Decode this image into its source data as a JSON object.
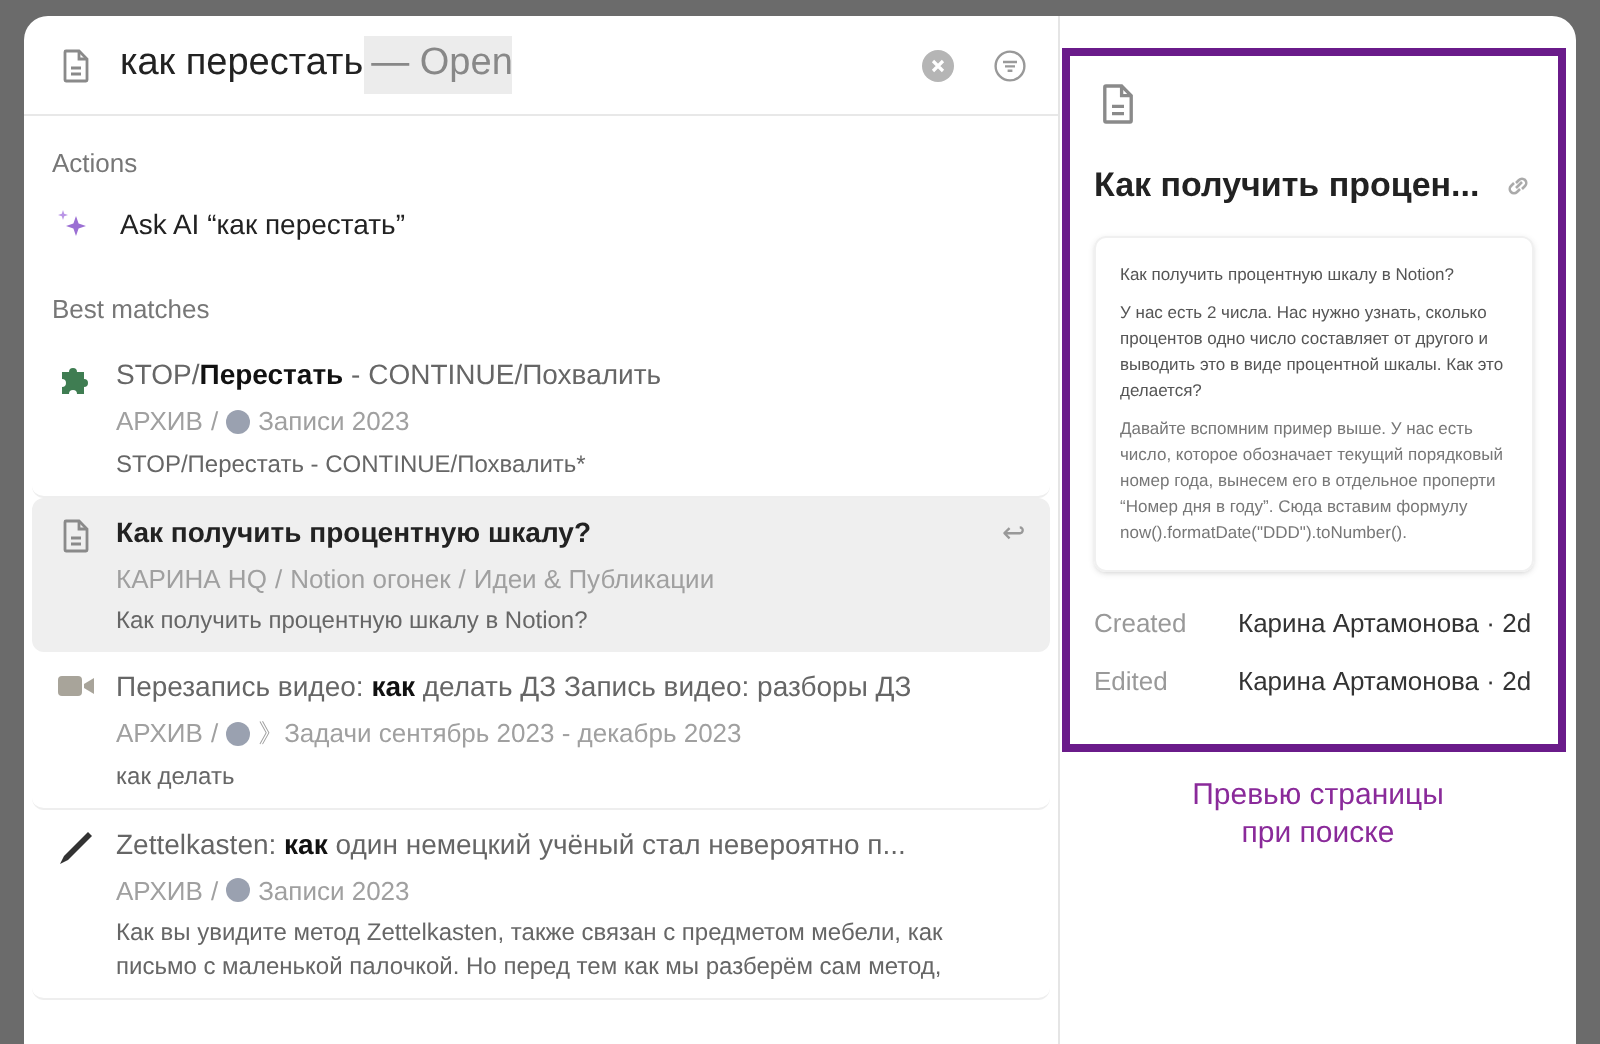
{
  "search": {
    "value": "как перестать",
    "suggestion": "— Open"
  },
  "actions": {
    "heading": "Actions",
    "items": [
      {
        "label": "Ask AI “как перестать”"
      }
    ]
  },
  "results": {
    "heading": "Best matches",
    "items": [
      {
        "kind": "puzzle",
        "selected": false,
        "title": "STOP/**Перестать** - CONTINUE/Похвалить",
        "breadcrumb": [
          {
            "kind": "text",
            "text": "АРХИВ"
          },
          {
            "kind": "text",
            "text": "/"
          },
          {
            "kind": "dot"
          },
          {
            "kind": "text",
            "text": "Записи 2023"
          }
        ],
        "snippet": "STOP/Перестать - CONTINUE/Похвалить*"
      },
      {
        "kind": "page",
        "selected": true,
        "title": "Как получить процентную шкалу?",
        "breadcrumb": [
          {
            "kind": "text",
            "text": "КАРИНА HQ"
          },
          {
            "kind": "text",
            "text": "/"
          },
          {
            "kind": "text",
            "text": "Notion огонек"
          },
          {
            "kind": "text",
            "text": "/"
          },
          {
            "kind": "text",
            "text": "Идеи & Публикации"
          }
        ],
        "snippet": "Как получить процентную шкалу в Notion?",
        "hint": "↩"
      },
      {
        "kind": "video",
        "selected": false,
        "title": "Перезапись видео: **как** делать ДЗ Запись видео: разборы ДЗ",
        "breadcrumb": [
          {
            "kind": "text",
            "text": "АРХИВ"
          },
          {
            "kind": "text",
            "text": "/"
          },
          {
            "kind": "dot"
          },
          {
            "kind": "text",
            "text": "》Задачи сентябрь 2023 - декабрь 2023"
          }
        ],
        "snippet": "как делать"
      },
      {
        "kind": "pen",
        "selected": false,
        "title": "Zettelkasten: **как** один немецкий учёный стал невероятно п...",
        "breadcrumb": [
          {
            "kind": "text",
            "text": "АРХИВ"
          },
          {
            "kind": "text",
            "text": "/"
          },
          {
            "kind": "dot"
          },
          {
            "kind": "text",
            "text": "Записи 2023"
          }
        ],
        "snippet": "Как вы увидите метод Zettelkasten, также связан с предметом мебели, как письмо с маленькой палочкой. Но перед тем как мы разберём сам метод,"
      }
    ]
  },
  "preview": {
    "title": "Как получить процен...",
    "paragraphs": [
      "Как получить процентную шкалу в Notion?",
      "У нас есть 2 числа. Нас нужно узнать, сколько процентов одно число составляет от другого и выводить это в виде процентной шкалы. Как это делается?",
      "Давайте вспомним пример выше. У нас есть число, которое обозначает текущий порядковый номер года, вынесем его в отдельное проперти “Номер дня в году”. Сюда вставим формулу now().formatDate(\"DDD\").toNumber()."
    ],
    "meta": [
      {
        "label": "Created",
        "value": "Карина Артамонова · 2d"
      },
      {
        "label": "Edited",
        "value": "Карина Артамонова · 2d"
      }
    ]
  },
  "caption": "Превью страницы\nпри поиске"
}
